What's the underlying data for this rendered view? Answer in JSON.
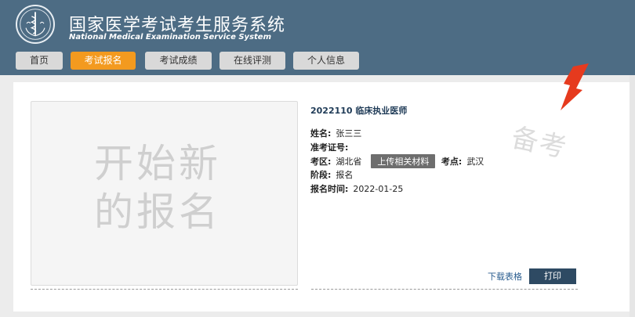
{
  "header": {
    "title_cn": "国家医学考试考生服务系统",
    "title_en": "National Medical Examination Service System",
    "logo_icon": "medical-caduceus-icon"
  },
  "nav": {
    "tabs": [
      {
        "label": "首页",
        "active": false
      },
      {
        "label": "考试报名",
        "active": true
      },
      {
        "label": "考试成绩",
        "active": false
      },
      {
        "label": "在线评测",
        "active": false
      },
      {
        "label": "个人信息",
        "active": false
      }
    ]
  },
  "card": {
    "start_text": "开始新的报名",
    "exam_title": "2022110 临床执业医师",
    "fields": {
      "name_label": "姓名:",
      "name_value": "张三三",
      "ticket_label": "准考证号:",
      "ticket_value": "",
      "region_label": "考区:",
      "region_value": "湖北省",
      "upload_label": "上传相关材料",
      "site_label": "考点:",
      "site_value": "武汉",
      "stage_label": "阶段:",
      "stage_value": "报名",
      "time_label": "报名时间:",
      "time_value": "2022-01-25"
    },
    "stamp_text": "备考",
    "download_label": "下载表格",
    "print_label": "打印"
  },
  "colors": {
    "header_bg": "#4d6c84",
    "active_tab": "#f39a1f",
    "print_btn": "#2e4a63",
    "arrow": "#e63a1e"
  }
}
